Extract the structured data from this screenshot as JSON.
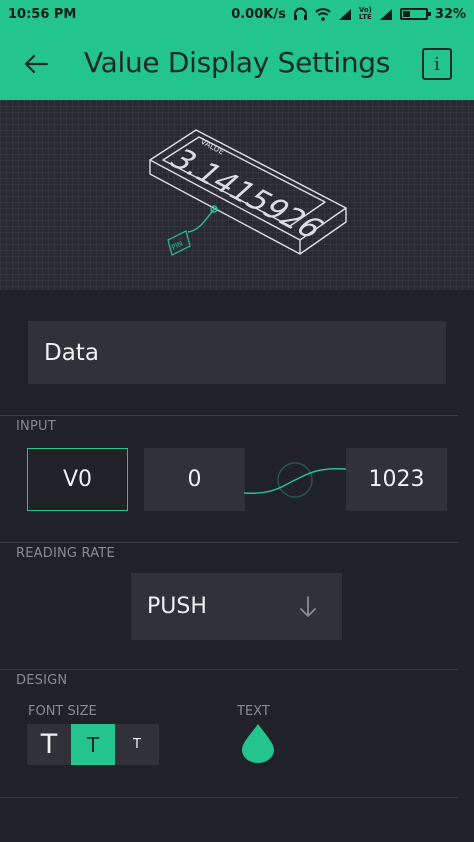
{
  "status_bar": {
    "time": "10:56 PM",
    "net_speed": "0.00K/s",
    "lte_label_top": "Vo)",
    "lte_label_bottom": "LTE",
    "battery_percent": "32%",
    "battery_level": 0.32
  },
  "app_bar": {
    "title": "Value Display Settings",
    "info_label": "i"
  },
  "preview": {
    "widget_caption": "VALUE",
    "widget_value": "3.1415926",
    "pin_label": "PIN"
  },
  "name_field": {
    "value": "Data"
  },
  "input_section": {
    "label": "INPUT",
    "pin": "V0",
    "min": "0",
    "max": "1023"
  },
  "reading_rate": {
    "label": "READING RATE",
    "selected": "PUSH"
  },
  "design": {
    "label": "DESIGN",
    "font_size_label": "FONT SIZE",
    "font_options": [
      {
        "glyph": "T",
        "active": false
      },
      {
        "glyph": "T",
        "active": true
      },
      {
        "glyph": "T",
        "active": false
      }
    ],
    "text_label": "TEXT",
    "text_color": "#23c48e"
  },
  "colors": {
    "accent": "#23c48e",
    "background": "#212227",
    "field": "#313238"
  }
}
